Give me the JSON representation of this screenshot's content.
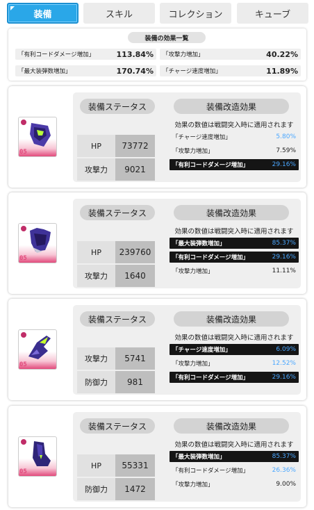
{
  "tabs": [
    "装備",
    "スキル",
    "コレクション",
    "キューブ"
  ],
  "summary": {
    "title": "装備の効果一覧",
    "rows": [
      {
        "name": "「有利コードダメージ増加」",
        "value": "113.84%"
      },
      {
        "name": "「攻撃力増加」",
        "value": "40.22%"
      },
      {
        "name": "「最大装弾数増加」",
        "value": "170.74%"
      },
      {
        "name": "「チャージ速度増加」",
        "value": "11.89%"
      }
    ]
  },
  "cards": [
    {
      "level": "05",
      "status_header": "装備ステータス",
      "mod_header": "装備改造効果",
      "note": "効果の数値は戦闘突入時に適用されます",
      "stats": [
        {
          "label": "HP",
          "value": "73772"
        },
        {
          "label": "攻撃力",
          "value": "9021"
        }
      ],
      "effects": [
        {
          "name": "「チャージ速度増加」",
          "value": "5.80%",
          "highlight": false,
          "color": "blue"
        },
        {
          "name": "「攻撃力増加」",
          "value": "7.59%",
          "highlight": false,
          "color": "dark"
        },
        {
          "name": "「有利コードダメージ増加」",
          "value": "29.16%",
          "highlight": true,
          "color": "blue"
        }
      ]
    },
    {
      "level": "05",
      "status_header": "装備ステータス",
      "mod_header": "装備改造効果",
      "note": "効果の数値は戦闘突入時に適用されます",
      "stats": [
        {
          "label": "HP",
          "value": "239760"
        },
        {
          "label": "攻撃力",
          "value": "1640"
        }
      ],
      "effects": [
        {
          "name": "「最大装弾数増加」",
          "value": "85.37%",
          "highlight": true,
          "color": "blue"
        },
        {
          "name": "「有利コードダメージ増加」",
          "value": "29.16%",
          "highlight": true,
          "color": "blue"
        },
        {
          "name": "「攻撃力増加」",
          "value": "11.11%",
          "highlight": false,
          "color": "dark"
        }
      ]
    },
    {
      "level": "05",
      "status_header": "装備ステータス",
      "mod_header": "装備改造効果",
      "note": "効果の数値は戦闘突入時に適用されます",
      "stats": [
        {
          "label": "攻撃力",
          "value": "5741"
        },
        {
          "label": "防御力",
          "value": "981"
        }
      ],
      "effects": [
        {
          "name": "「チャージ速度増加」",
          "value": "6.09%",
          "highlight": true,
          "color": "blue"
        },
        {
          "name": "「攻撃力増加」",
          "value": "12.52%",
          "highlight": false,
          "color": "blue"
        },
        {
          "name": "「有利コードダメージ増加」",
          "value": "29.16%",
          "highlight": true,
          "color": "blue"
        }
      ]
    },
    {
      "level": "05",
      "status_header": "装備ステータス",
      "mod_header": "装備改造効果",
      "note": "効果の数値は戦闘突入時に適用されます",
      "stats": [
        {
          "label": "HP",
          "value": "55331"
        },
        {
          "label": "防御力",
          "value": "1472"
        }
      ],
      "effects": [
        {
          "name": "「最大装弾数増加」",
          "value": "85.37%",
          "highlight": true,
          "color": "blue"
        },
        {
          "name": "「有利コードダメージ増加」",
          "value": "26.36%",
          "highlight": false,
          "color": "blue"
        },
        {
          "name": "「攻撃力増加」",
          "value": "9.00%",
          "highlight": false,
          "color": "dark"
        }
      ]
    }
  ]
}
